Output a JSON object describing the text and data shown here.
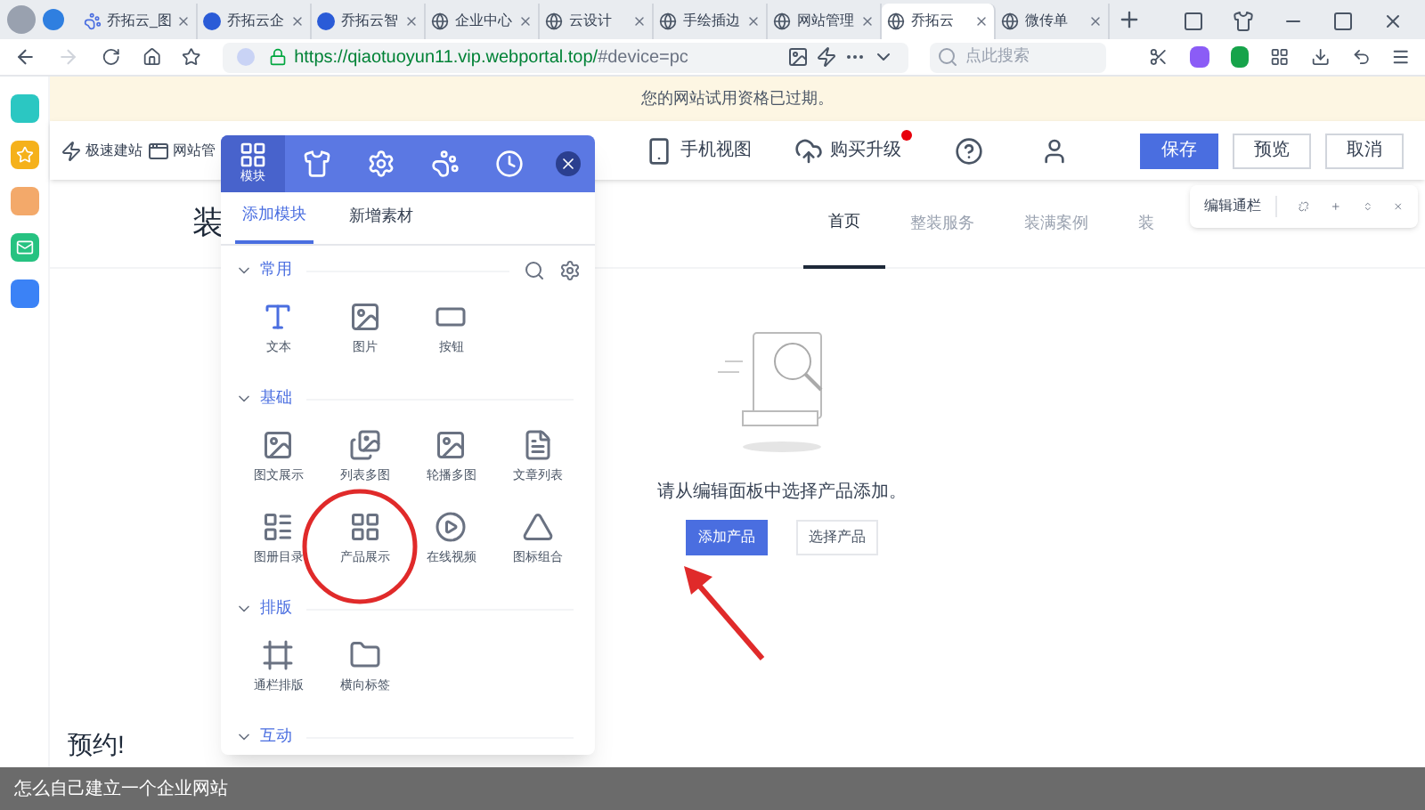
{
  "browser": {
    "tabs": [
      {
        "label": "乔拓云_图",
        "selected": false
      },
      {
        "label": "乔拓云企",
        "selected": false
      },
      {
        "label": "乔拓云智",
        "selected": false
      },
      {
        "label": "企业中心",
        "selected": false
      },
      {
        "label": "云设计",
        "selected": false
      },
      {
        "label": "手绘插边",
        "selected": false
      },
      {
        "label": "网站管理",
        "selected": false
      },
      {
        "label": "乔拓云",
        "selected": true
      },
      {
        "label": "微传单",
        "selected": false
      }
    ],
    "url_host": "https://qiaotuoyun11.vip.webportal.top/",
    "url_rest": "#device=pc",
    "search_placeholder": "点此搜索"
  },
  "notice": "您的网站试用资格已过期。",
  "toolbar": {
    "left": [
      {
        "label": "极速建站"
      },
      {
        "label": "网站管"
      }
    ],
    "right": [
      {
        "label": "手机视图",
        "badge": false
      },
      {
        "label": "购买升级",
        "badge": true
      }
    ],
    "buttons": [
      {
        "label": "保存",
        "kind": "primary"
      },
      {
        "label": "预览",
        "kind": "default"
      },
      {
        "label": "取消",
        "kind": "default"
      }
    ]
  },
  "panel": {
    "top_tabs": [
      {
        "label": "模块",
        "selected": true
      },
      {
        "selected": false
      },
      {
        "selected": false
      },
      {
        "selected": false
      },
      {
        "selected": false
      }
    ],
    "sub_tabs": [
      {
        "label": "添加模块",
        "selected": true
      },
      {
        "label": "新增素材",
        "selected": false
      }
    ],
    "sections": [
      {
        "title": "常用",
        "expanded": true,
        "items": [
          {
            "label": "文本",
            "kind": "text"
          },
          {
            "label": "图片",
            "kind": "image"
          },
          {
            "label": "按钮",
            "kind": "button"
          }
        ]
      },
      {
        "title": "基础",
        "expanded": true,
        "items": [
          {
            "label": "图文展示",
            "kind": "image"
          },
          {
            "label": "列表多图",
            "kind": "images"
          },
          {
            "label": "轮播多图",
            "kind": "carousel"
          },
          {
            "label": "文章列表",
            "kind": "doc"
          },
          {
            "label": "图册目录",
            "kind": "list"
          },
          {
            "label": "产品展示",
            "kind": "grid"
          },
          {
            "label": "在线视频",
            "kind": "play"
          },
          {
            "label": "图标组合",
            "kind": "triangle"
          }
        ]
      },
      {
        "title": "排版",
        "expanded": true,
        "items": [
          {
            "label": "通栏排版",
            "kind": "frame"
          },
          {
            "label": "横向标签",
            "kind": "folder"
          }
        ]
      },
      {
        "title": "互动",
        "expanded": true
      }
    ]
  },
  "page": {
    "heading": "装",
    "nav": [
      {
        "label": "首页",
        "selected": true
      },
      {
        "label": "整装服务",
        "selected": false
      },
      {
        "label": "装满案例",
        "selected": false
      },
      {
        "label": "装",
        "selected": false
      }
    ],
    "empty_message": "请从编辑面板中选择产品添加。",
    "primary_button": "添加产品",
    "secondary_button": "选择产品",
    "footer_heading": "预约!"
  },
  "section_toolbar": {
    "label": "编辑通栏"
  },
  "caption": "怎么自己建立一个企业网站"
}
